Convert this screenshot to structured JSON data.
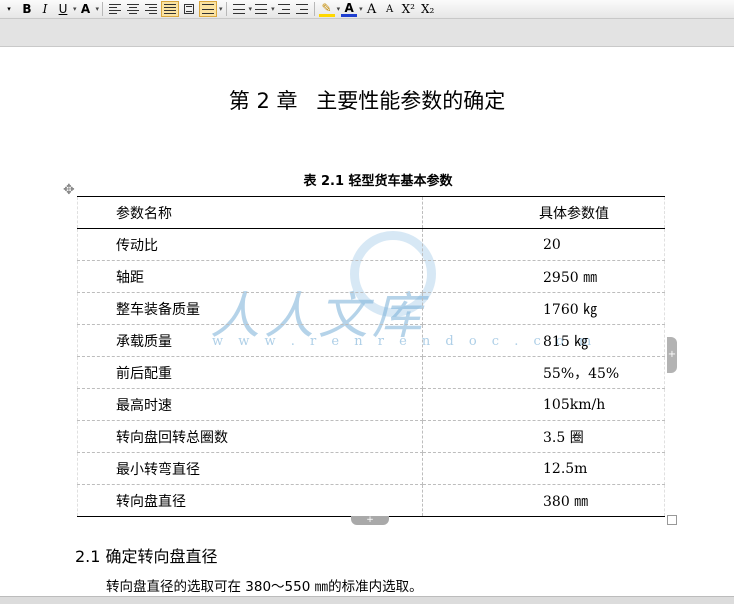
{
  "toolbar": {
    "bold": "B",
    "italic": "I",
    "underline": "U",
    "font_color_a": "A",
    "highlight_a": "A",
    "grow_font": "A",
    "shrink_font": "A",
    "superscript": "X²",
    "subscript": "X₂"
  },
  "document": {
    "chapter_title": {
      "num": "第 2 章",
      "text": "主要性能参数的确定"
    },
    "table_caption": "表 2.1 轻型货车基本参数",
    "table": {
      "header": [
        "参数名称",
        "具体参数值"
      ],
      "rows": [
        [
          "传动比",
          "20"
        ],
        [
          "轴距",
          "2950 ㎜"
        ],
        [
          "整车装备质量",
          "1760 ㎏"
        ],
        [
          "承载质量",
          "815 ㎏"
        ],
        [
          "前后配重",
          "55%，45%"
        ],
        [
          "最高时速",
          "105km/h"
        ],
        [
          "转向盘回转总圈数",
          "3.5 圈"
        ],
        [
          "最小转弯直径",
          "12.5m"
        ],
        [
          "转向盘直径",
          "380 ㎜"
        ]
      ]
    },
    "section_heading": "2.1 确定转向盘直径",
    "paragraph": "转向盘直径的选取可在 380～550 ㎜的标准内选取。"
  },
  "watermark": {
    "text": "人人文库",
    "url": "w w w . r e n r e n d o c . c o m"
  },
  "colors": {
    "highlight_active": "#fbe3a2",
    "font_color_underline": "#1f3fd0",
    "highlight_underline": "#ffd800",
    "watermark": "#78afd7"
  }
}
